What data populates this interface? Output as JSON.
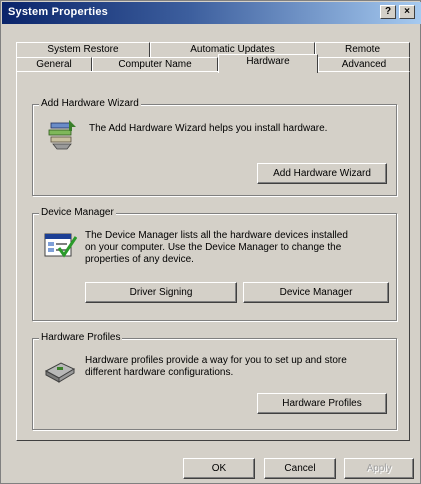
{
  "window": {
    "title": "System Properties",
    "help_glyph": "?",
    "close_glyph": "×"
  },
  "tabs": {
    "row_back": [
      "System Restore",
      "Automatic Updates",
      "Remote"
    ],
    "row_front": [
      "General",
      "Computer Name",
      "Hardware",
      "Advanced"
    ],
    "selected": "Hardware"
  },
  "add_hardware": {
    "group_title": "Add Hardware Wizard",
    "description": "The Add Hardware Wizard helps you install hardware.",
    "button_label": "Add Hardware Wizard"
  },
  "device_manager": {
    "group_title": "Device Manager",
    "description_lines": [
      "The Device Manager lists all the hardware devices installed",
      "on your computer. Use the Device Manager to change the",
      "properties of any device."
    ],
    "driver_signing_label": "Driver Signing",
    "device_manager_label": "Device Manager"
  },
  "hardware_profiles": {
    "group_title": "Hardware Profiles",
    "description_lines": [
      "Hardware profiles provide a way for you to set up and store",
      "different hardware configurations."
    ],
    "button_label": "Hardware Profiles"
  },
  "footer": {
    "ok_label": "OK",
    "cancel_label": "Cancel",
    "apply_label": "Apply"
  }
}
